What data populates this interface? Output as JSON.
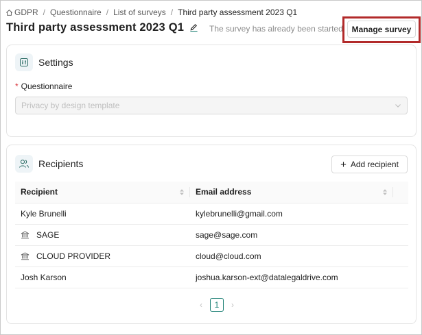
{
  "breadcrumb": {
    "items": [
      "GDPR",
      "Questionnaire",
      "List of surveys",
      "Third party assessment 2023 Q1"
    ],
    "separator": "/"
  },
  "header": {
    "title": "Third party assessment 2023 Q1",
    "status_note": "The survey has already been started",
    "manage_label": "Manage survey"
  },
  "settings": {
    "heading": "Settings",
    "questionnaire_label": "Questionnaire",
    "questionnaire_value": "Privacy by design template"
  },
  "recipients": {
    "heading": "Recipients",
    "add_label": "Add recipient",
    "columns": [
      "Recipient",
      "Email address"
    ],
    "rows": [
      {
        "name": "Kyle Brunelli",
        "email": "kylebrunelli@gmail.com",
        "icon": ""
      },
      {
        "name": "SAGE",
        "email": "sage@sage.com",
        "icon": "bank-icon"
      },
      {
        "name": "CLOUD PROVIDER",
        "email": "cloud@cloud.com",
        "icon": "bank-icon"
      },
      {
        "name": "Josh Karson",
        "email": "joshua.karson-ext@datalegaldrive.com",
        "icon": ""
      }
    ]
  },
  "pagination": {
    "current": "1",
    "prev": "‹",
    "next": "›"
  },
  "colors": {
    "accent": "#1a7f73",
    "highlight_border": "#b22a2a",
    "required": "#d9363e"
  }
}
